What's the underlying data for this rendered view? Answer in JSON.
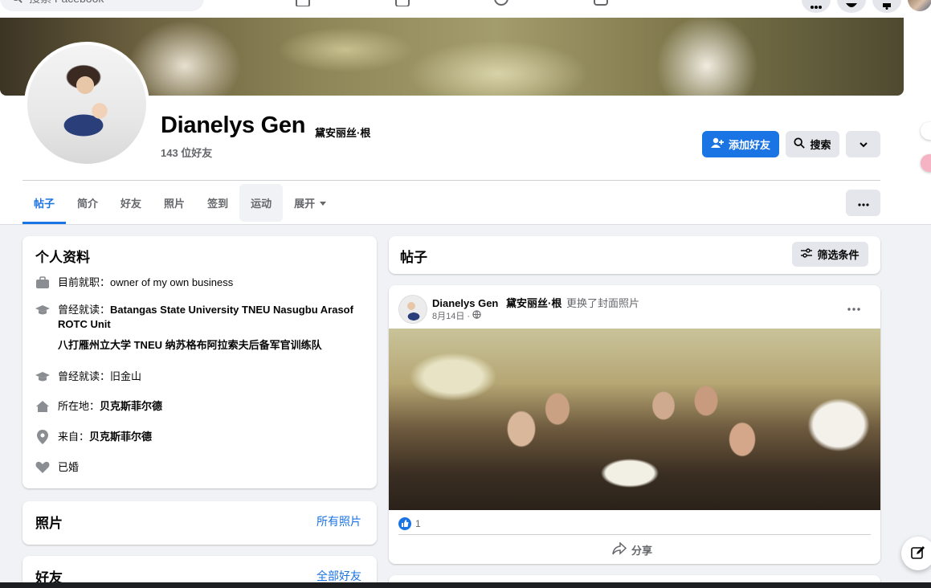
{
  "topnav": {
    "search_placeholder": "搜索 Facebook"
  },
  "profile": {
    "name": "Dianelys Gen",
    "alt_name": "黛安丽丝·根",
    "friend_count": "143 位好友",
    "add_friend_label": "添加好友",
    "search_label": "搜索"
  },
  "tabs": [
    {
      "label": "帖子"
    },
    {
      "label": "简介"
    },
    {
      "label": "好友"
    },
    {
      "label": "照片"
    },
    {
      "label": "签到"
    },
    {
      "label": "运动"
    },
    {
      "label": "展开"
    }
  ],
  "intro": {
    "title": "个人资料",
    "work_prefix": "目前就职：",
    "work_value": "owner of my own business",
    "edu1_prefix": "曾经就读：",
    "edu1_value": "Batangas State University TNEU Nasugbu Arasof ROTC Unit",
    "edu1_translation": "八打雁州立大学 TNEU 纳苏格布阿拉索夫后备军官训练队",
    "edu2_prefix": "曾经就读：",
    "edu2_value": "旧金山",
    "lives_prefix": "所在地：",
    "lives_value": "贝克斯菲尔德",
    "from_prefix": "来自：",
    "from_value": "贝克斯菲尔德",
    "relationship": "已婚"
  },
  "photos_card": {
    "title": "照片",
    "link": "所有照片"
  },
  "friends_card": {
    "title": "好友",
    "link": "全部好友"
  },
  "posts_header": {
    "title": "帖子",
    "filter_label": "筛选条件"
  },
  "post": {
    "author": "Dianelys Gen",
    "author_alt": "黛安丽丝·根",
    "action": "更换了封面照片",
    "date": "8月14日 ·",
    "like_count": "1",
    "share_label": "分享"
  },
  "colors": {
    "accent": "#1b74e4",
    "background": "#f0f2f5"
  }
}
